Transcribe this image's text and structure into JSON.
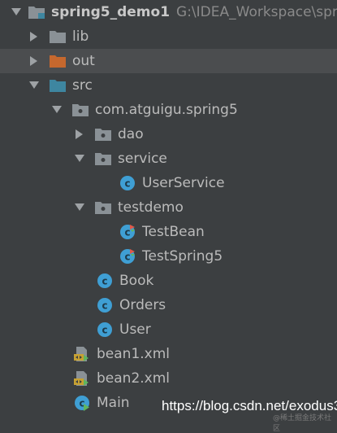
{
  "project": {
    "name": "spring5_demo1",
    "path": "G:\\IDEA_Workspace\\spr"
  },
  "tree": [
    {
      "label": "lib",
      "icon": "folder-icon",
      "arrow": "collapsed"
    },
    {
      "label": "out",
      "icon": "excluded-folder-icon",
      "arrow": "collapsed"
    },
    {
      "label": "src",
      "icon": "source-folder-icon",
      "arrow": "expanded"
    },
    {
      "label": "com.atguigu.spring5",
      "icon": "package-icon",
      "arrow": "expanded"
    },
    {
      "label": "dao",
      "icon": "package-icon",
      "arrow": "collapsed"
    },
    {
      "label": "service",
      "icon": "package-icon",
      "arrow": "expanded"
    },
    {
      "label": "UserService",
      "icon": "class-icon"
    },
    {
      "label": "testdemo",
      "icon": "package-icon",
      "arrow": "expanded"
    },
    {
      "label": "TestBean",
      "icon": "test-class-icon"
    },
    {
      "label": "TestSpring5",
      "icon": "test-class-icon"
    },
    {
      "label": "Book",
      "icon": "class-icon"
    },
    {
      "label": "Orders",
      "icon": "class-icon"
    },
    {
      "label": "User",
      "icon": "class-icon"
    },
    {
      "label": "bean1.xml",
      "icon": "xml-file-icon"
    },
    {
      "label": "bean2.xml",
      "icon": "xml-file-icon"
    },
    {
      "label": "Main",
      "icon": "main-class-icon"
    }
  ],
  "watermark": "https://blog.csdn.net/exodus3",
  "watermark_small": "@稀土掘金技术社区",
  "colors": {
    "background": "#3c3f41",
    "selection": "#4b4d4f",
    "folder": "#8a9196",
    "excluded_folder": "#c6682e",
    "source_folder": "#3e86a0",
    "class_badge": "#3f9fd4"
  }
}
